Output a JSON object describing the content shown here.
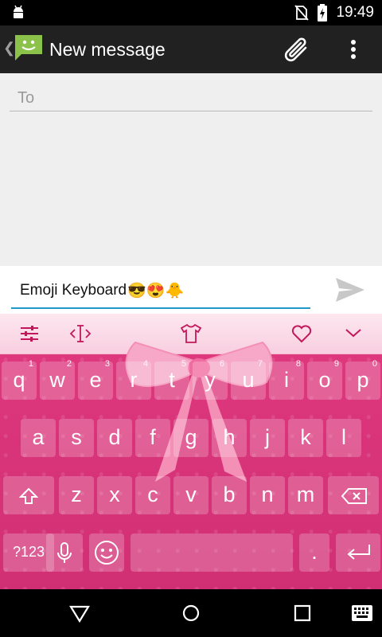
{
  "status_bar": {
    "time": "19:49",
    "icons": [
      "android-icon",
      "no-sim-icon",
      "battery-charging-icon"
    ]
  },
  "action_bar": {
    "title": "New message",
    "icons": [
      "messaging-app-icon",
      "attach-icon",
      "overflow-menu-icon"
    ]
  },
  "compose": {
    "to_placeholder": "To"
  },
  "message": {
    "text": "Emoji Keyboard",
    "emojis": "😎😍🐥"
  },
  "keyboard": {
    "toolbar": [
      "settings-sliders-icon",
      "cursor-icon",
      "theme-shirt-icon",
      "heart-icon",
      "collapse-chevron-icon"
    ],
    "row1": [
      {
        "ch": "q",
        "num": "1"
      },
      {
        "ch": "w",
        "num": "2"
      },
      {
        "ch": "e",
        "num": "3"
      },
      {
        "ch": "r",
        "num": "4"
      },
      {
        "ch": "t",
        "num": "5"
      },
      {
        "ch": "y",
        "num": "6"
      },
      {
        "ch": "u",
        "num": "7"
      },
      {
        "ch": "i",
        "num": "8"
      },
      {
        "ch": "o",
        "num": "9"
      },
      {
        "ch": "p",
        "num": "0"
      }
    ],
    "row2": [
      "a",
      "s",
      "d",
      "f",
      "g",
      "h",
      "j",
      "k",
      "l"
    ],
    "row3": [
      "z",
      "x",
      "c",
      "v",
      "b",
      "n",
      "m"
    ],
    "row4": {
      "symbols": "?123",
      "period": "."
    },
    "colors": {
      "key_bg": "#d83a7c",
      "toolbar_bg": "#fbe0ea",
      "accent": "#2196c8"
    }
  }
}
